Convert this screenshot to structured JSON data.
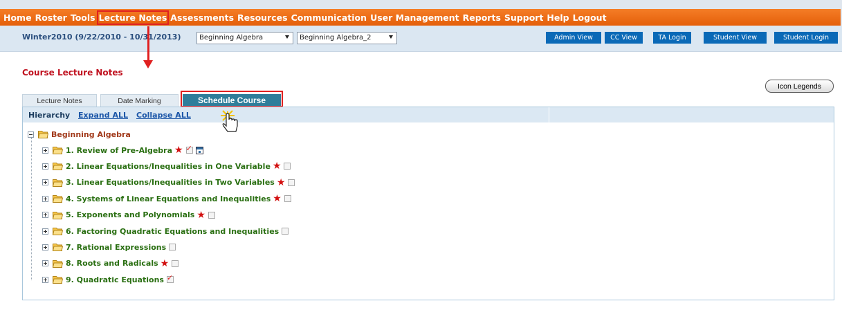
{
  "nav": {
    "items": [
      "Home",
      "Roster",
      "Tools",
      "Lecture Notes",
      "Assessments",
      "Resources",
      "Communication",
      "User Management",
      "Reports",
      "Support",
      "Help",
      "Logout"
    ],
    "active_index": 3
  },
  "context": {
    "semester": "Winter2010 (9/22/2010 - 10/31/2013)",
    "course_select": "Beginning Algebra",
    "section_select": "Beginning Algebra_2"
  },
  "views": {
    "admin_view": "Admin View",
    "cc_view": "CC View",
    "ta_login": "TA Login",
    "student_view": "Student View",
    "student_login": "Student Login"
  },
  "page": {
    "title": "Course Lecture Notes",
    "icon_legends": "Icon Legends"
  },
  "tabs": {
    "lecture_notes": "Lecture Notes",
    "date_marking": "Date Marking",
    "schedule_course": "Schedule Course",
    "active": "schedule_course"
  },
  "hierarchy": {
    "label": "Hierarchy",
    "expand_all": "Expand ALL",
    "collapse_all": "Collapse ALL"
  },
  "tree": {
    "root": "Beginning Algebra",
    "items": [
      {
        "label": "1. Review of Pre-Algebra",
        "star": true,
        "checkbox": "checked",
        "calendar_icon": true
      },
      {
        "label": "2. Linear Equations/Inequalities in One Variable",
        "star": true,
        "checkbox": "empty"
      },
      {
        "label": "3. Linear Equations/Inequalities in Two Variables",
        "star": true,
        "checkbox": "empty"
      },
      {
        "label": "4. Systems of Linear Equations and Inequalities",
        "star": true,
        "checkbox": "empty"
      },
      {
        "label": "5. Exponents and Polynomials",
        "star": true,
        "checkbox": "empty"
      },
      {
        "label": "6. Factoring Quadratic Equations and Inequalities",
        "star": false,
        "checkbox": "empty"
      },
      {
        "label": "7. Rational Expressions",
        "star": false,
        "checkbox": "empty"
      },
      {
        "label": "8. Roots and Radicals",
        "star": true,
        "checkbox": "empty"
      },
      {
        "label": "9. Quadratic Equations",
        "star": false,
        "checkbox": "checked"
      }
    ]
  },
  "colors": {
    "nav_orange": "#e45f0a",
    "highlight_red": "#e02020",
    "active_tab": "#2f7d9a",
    "view_button_blue": "#0a69b7",
    "tree_label_green": "#2a6f12"
  }
}
